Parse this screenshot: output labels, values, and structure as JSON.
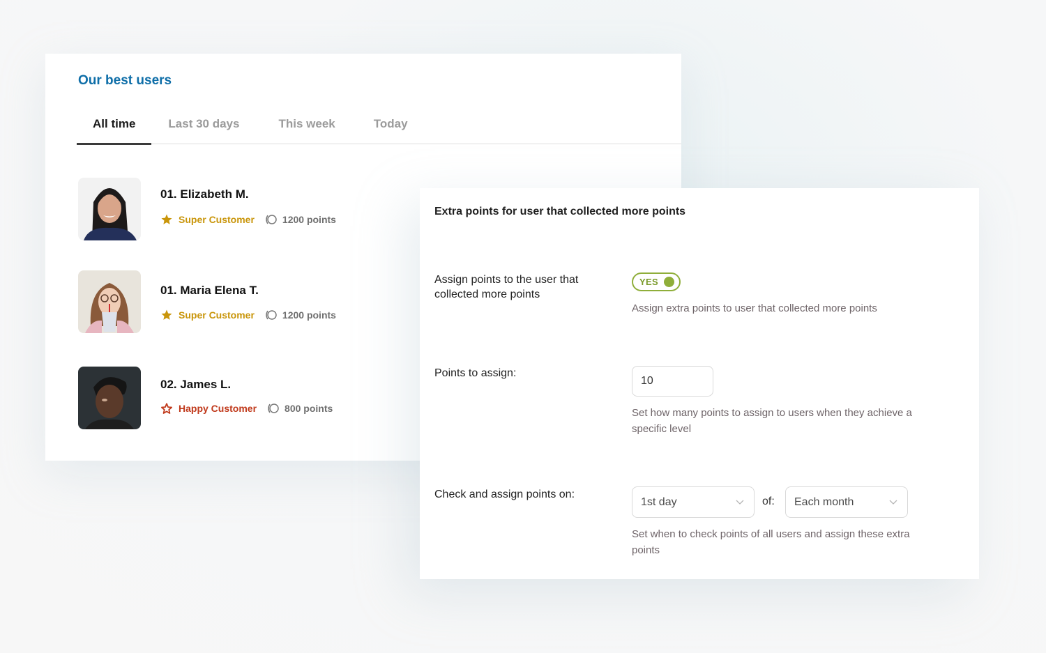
{
  "best_users": {
    "title": "Our best users",
    "tabs": [
      {
        "label": "All time",
        "active": true
      },
      {
        "label": "Last 30 days",
        "active": false
      },
      {
        "label": "This week",
        "active": false
      },
      {
        "label": "Today",
        "active": false
      }
    ],
    "users": [
      {
        "rank_name": "01. Elizabeth M.",
        "badge": "Super Customer",
        "badge_color": "#c9950a",
        "badge_icon": "star-filled-icon",
        "points": "1200 points"
      },
      {
        "rank_name": "01. Maria Elena T.",
        "badge": "Super Customer",
        "badge_color": "#c9950a",
        "badge_icon": "star-filled-icon",
        "points": "1200 points"
      },
      {
        "rank_name": "02. James L.",
        "badge": "Happy Customer",
        "badge_color": "#c0391b",
        "badge_icon": "star-outline-icon",
        "points": "800 points"
      }
    ]
  },
  "settings": {
    "title": "Extra points for user that collected more points",
    "assign_toggle": {
      "label": "Assign points to the user that collected more points",
      "value": "YES",
      "enabled": true,
      "help": "Assign extra points to user that collected more points"
    },
    "points_to_assign": {
      "label": "Points to assign:",
      "value": "10",
      "help": "Set how many points to assign to users when they achieve a specific level"
    },
    "check_schedule": {
      "label": "Check and assign points on:",
      "day_value": "1st day",
      "of_label": "of:",
      "period_value": "Each month",
      "help": "Set when to check points of all users and assign these extra points"
    }
  },
  "colors": {
    "title_blue": "#0e6ea8",
    "toggle_green": "#8fae3a",
    "super_gold": "#c9950a",
    "happy_red": "#c0391b"
  }
}
